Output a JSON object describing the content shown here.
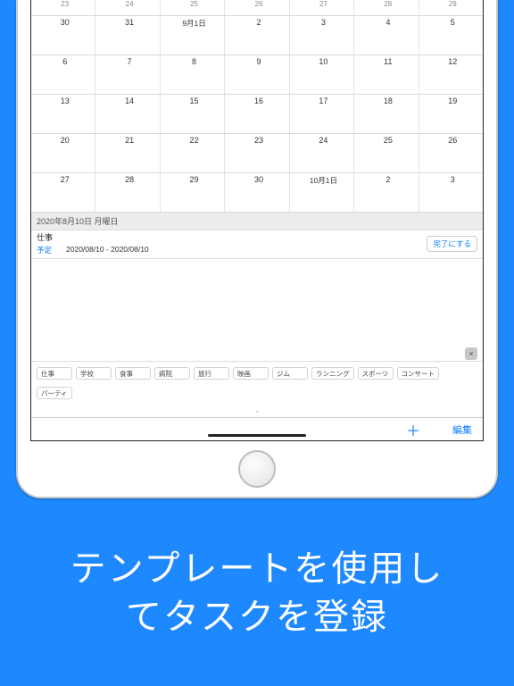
{
  "calendar": {
    "rows": [
      [
        "23",
        "24",
        "25",
        "26",
        "27",
        "28",
        "29"
      ],
      [
        "30",
        "31",
        "9月1日",
        "2",
        "3",
        "4",
        "5"
      ],
      [
        "6",
        "7",
        "8",
        "9",
        "10",
        "11",
        "12"
      ],
      [
        "13",
        "14",
        "15",
        "16",
        "17",
        "18",
        "19"
      ],
      [
        "20",
        "21",
        "22",
        "23",
        "24",
        "25",
        "26"
      ],
      [
        "27",
        "28",
        "29",
        "30",
        "10月1日",
        "2",
        "3"
      ]
    ]
  },
  "selected_day": {
    "header": "2020年8月10日  月曜日",
    "task_title": "仕事",
    "task_tag": "予定",
    "task_dates": "2020/08/10 - 2020/08/10",
    "complete_label": "完了にする"
  },
  "templates": {
    "close": "×",
    "row1": [
      "仕事",
      "学校",
      "食事",
      "病院",
      "旅行",
      "映画",
      "ジム",
      "ランニング",
      "スポーツ",
      "コンサート"
    ],
    "row2": [
      "パーティ"
    ]
  },
  "toolbar": {
    "add": "＋",
    "edit": "編集"
  },
  "promo": {
    "line1": "テンプレートを使用し",
    "line2": "てタスクを登録"
  }
}
